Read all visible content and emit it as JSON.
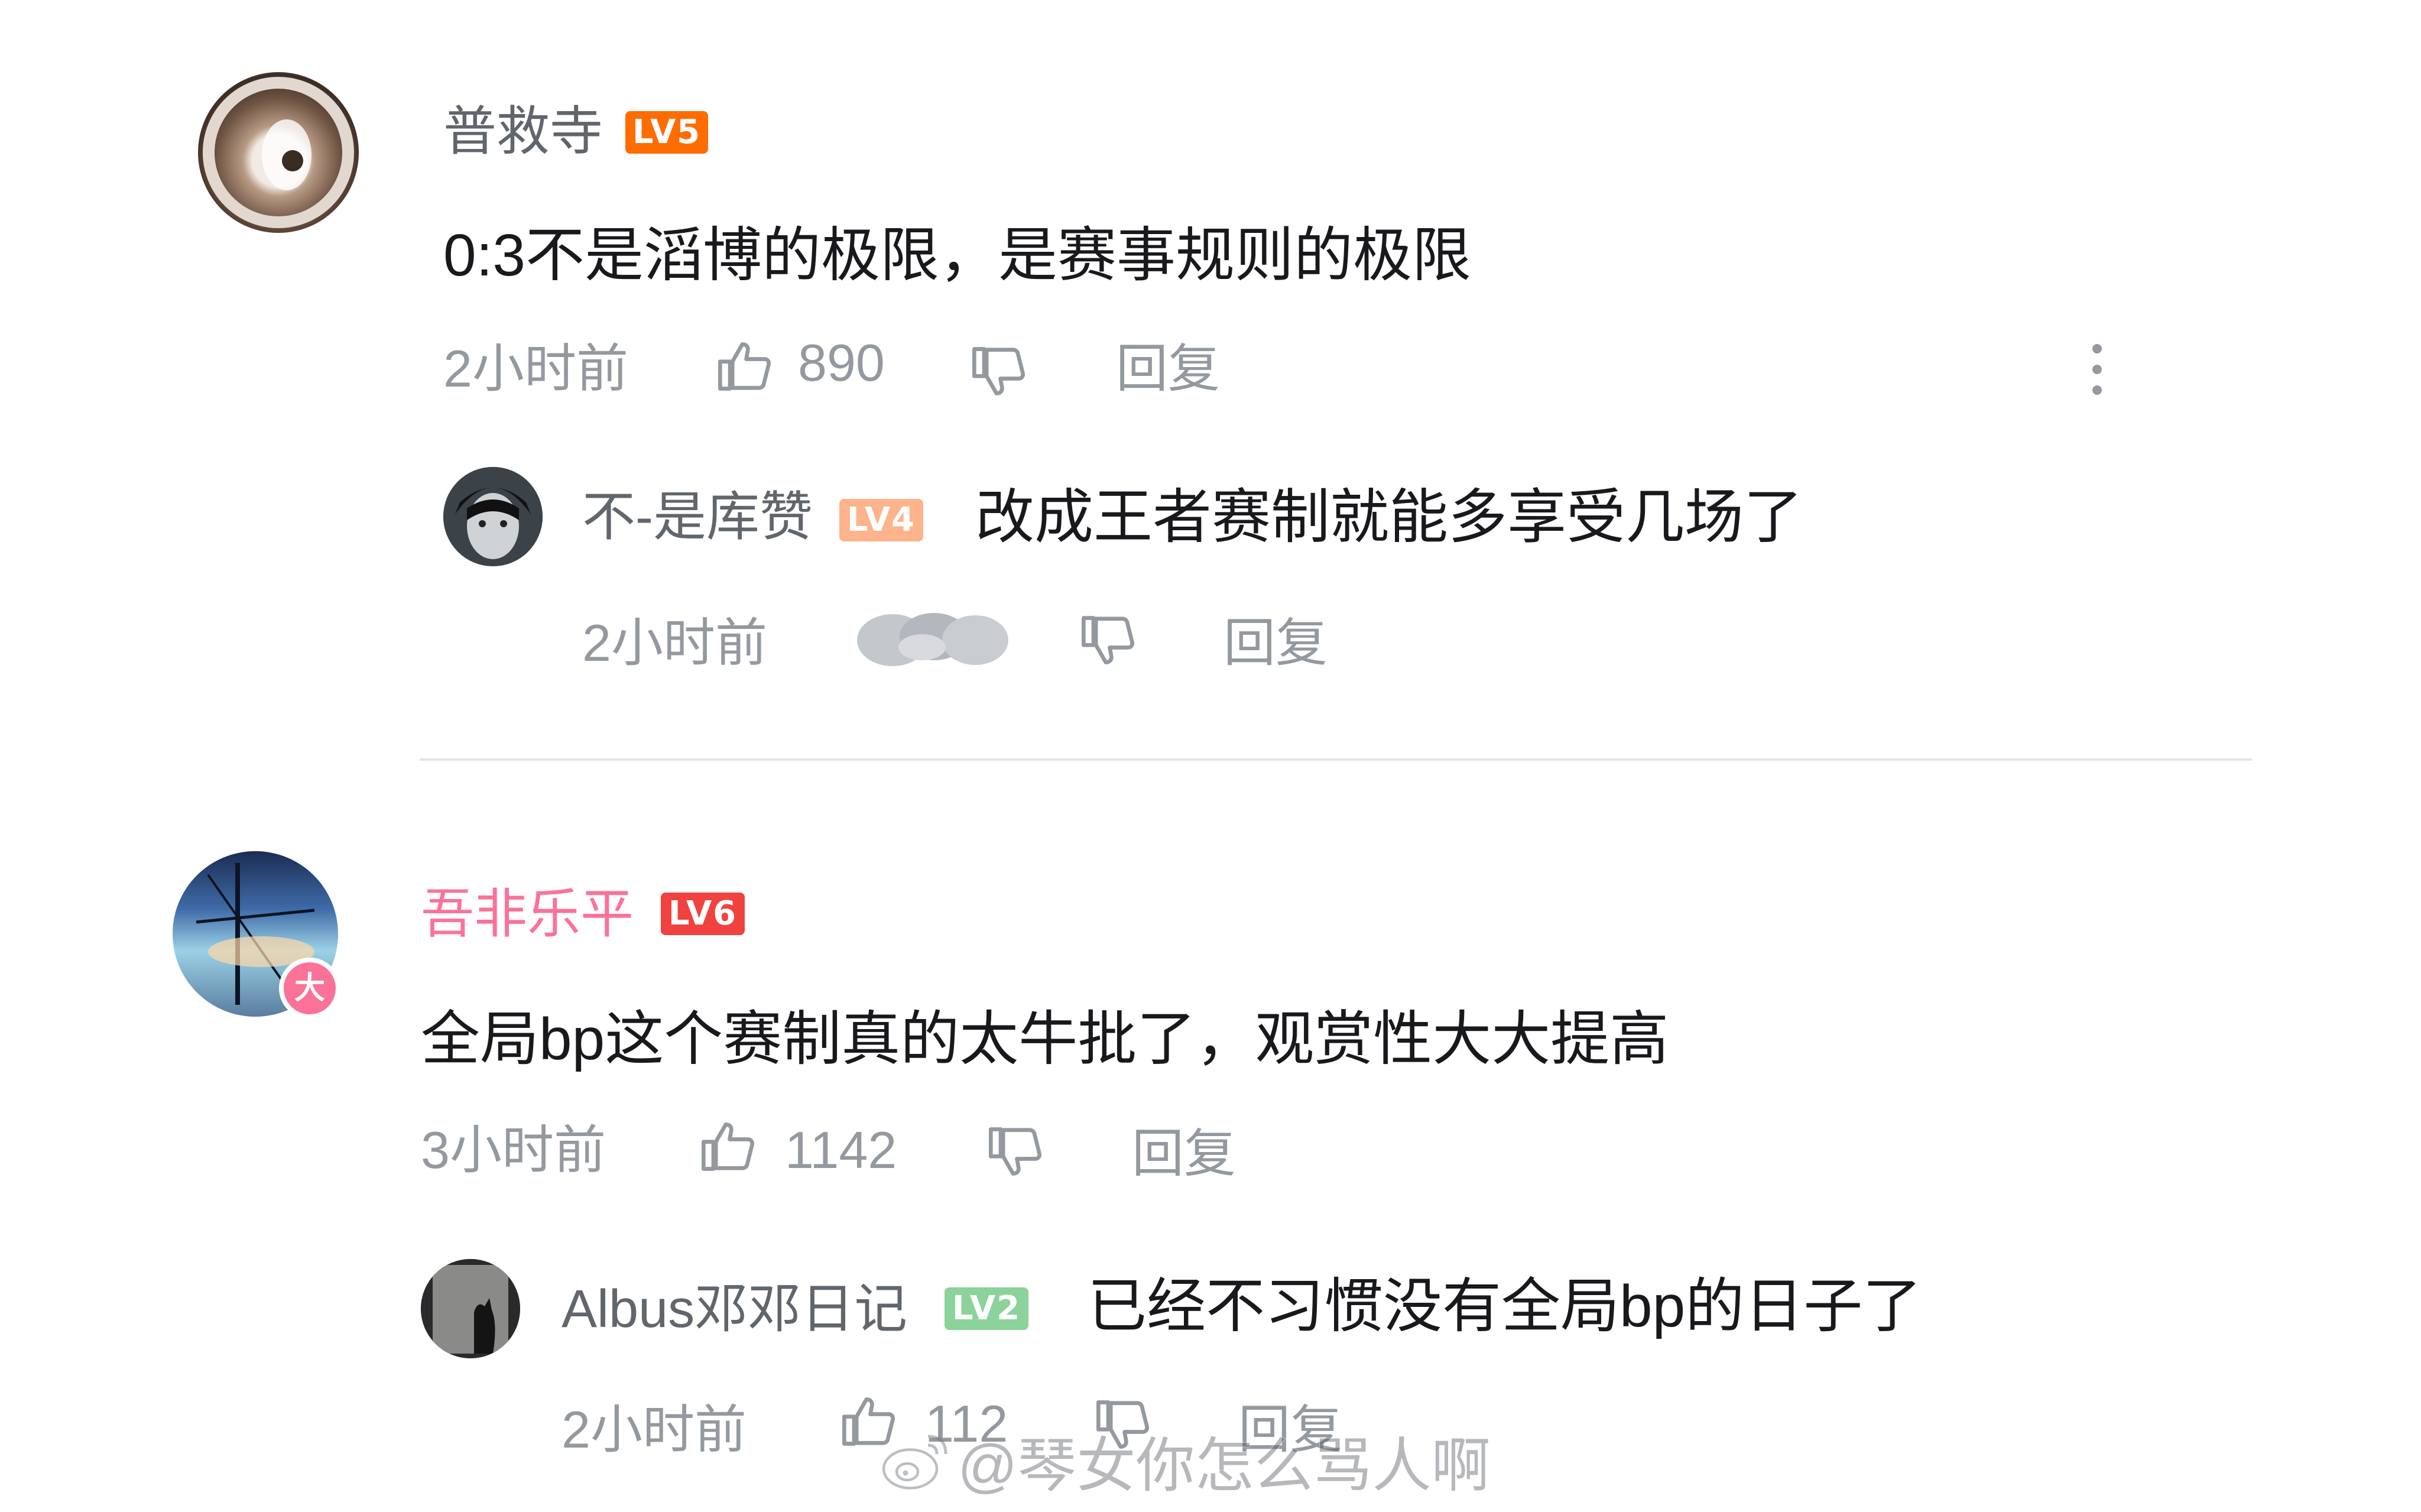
{
  "colors": {
    "text": "#18191c",
    "meta": "#9499a0",
    "vip_name": "#fb7299",
    "lv4": "#fdb38b",
    "lv5": "#ff6c00",
    "lv6": "#f0423f",
    "lv2": "#8bd29b",
    "divider": "#e3e5e7"
  },
  "comments": [
    {
      "username": "普救寺",
      "level": "LV5",
      "content": "0:3不是滔博的极限，是赛事规则的极限",
      "time": "2小时前",
      "likes": "890",
      "reply_label": "回复",
      "reply": {
        "username": "不-是库赞",
        "level": "LV4",
        "content": "改成王者赛制就能多享受几场了",
        "time": "2小时前",
        "reply_label": "回复"
      }
    },
    {
      "username": "吾非乐平",
      "level": "LV6",
      "badge": "大",
      "content": "全局bp这个赛制真的太牛批了，观赏性大大提高",
      "time": "3小时前",
      "likes": "1142",
      "reply_label": "回复",
      "reply": {
        "username": "Albus邓邓日记",
        "level": "LV2",
        "content": "已经不习惯没有全局bp的日子了",
        "time": "2小时前",
        "likes": "112",
        "reply_label": "回复"
      }
    }
  ],
  "watermark": "@琴女你怎么骂人啊"
}
